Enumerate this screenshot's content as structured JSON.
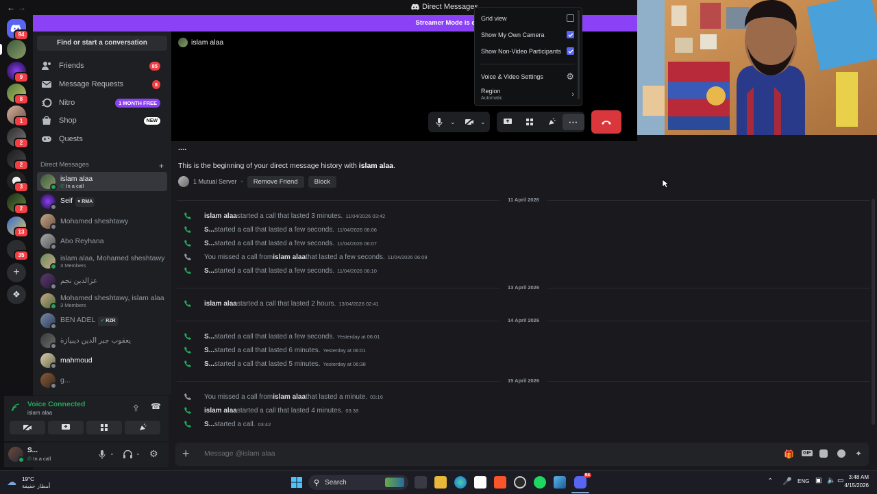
{
  "window": {
    "title": "Direct Messages"
  },
  "banner": {
    "text": "Streamer Mode is enabled. Usernames have b"
  },
  "rail": {
    "servers": [
      {
        "badge": "94"
      },
      {
        "badge": ""
      },
      {
        "badge": "9"
      },
      {
        "badge": "8"
      },
      {
        "badge": "1"
      },
      {
        "badge": "2"
      },
      {
        "badge": "2"
      },
      {
        "badge": "3"
      },
      {
        "badge": "2"
      },
      {
        "badge": "13"
      },
      {
        "badge": "35"
      }
    ]
  },
  "sidebar": {
    "find_label": "Find or start a conversation",
    "nav": [
      {
        "label": "Friends",
        "badge": "85"
      },
      {
        "label": "Message Requests",
        "badge": "8"
      },
      {
        "label": "Nitro",
        "badge": "1 MONTH FREE"
      },
      {
        "label": "Shop",
        "badge": "NEW"
      },
      {
        "label": "Quests",
        "badge": ""
      }
    ],
    "dm_header": "Direct Messages",
    "dms": [
      {
        "name": "islam alaa",
        "sub": "In a call",
        "tag": ""
      },
      {
        "name": "Seif",
        "sub": "",
        "tag": "RMA"
      },
      {
        "name": "Mohamed sheshtawy",
        "sub": "",
        "tag": ""
      },
      {
        "name": "Abo Reyhana",
        "sub": "",
        "tag": ""
      },
      {
        "name": "islam alaa, Mohamed sheshtawy",
        "sub": "3 Members",
        "tag": ""
      },
      {
        "name": "عزالدين نجم",
        "sub": "",
        "tag": ""
      },
      {
        "name": "Mohamed sheshtawy, islam alaa",
        "sub": "3 Members",
        "tag": ""
      },
      {
        "name": "BEN ADEL",
        "sub": "",
        "tag": "RZR"
      },
      {
        "name": "يعقوب جبر الدين ديبيازة",
        "sub": "",
        "tag": ""
      },
      {
        "name": "mahmoud",
        "sub": "",
        "tag": ""
      },
      {
        "name": "g...",
        "sub": "",
        "tag": ""
      }
    ]
  },
  "voice": {
    "status": "Voice Connected",
    "channel": "islam alaa"
  },
  "user": {
    "name": "S...",
    "status": "In a call"
  },
  "call": {
    "participant": "islam alaa"
  },
  "menu": {
    "grid_view": "Grid view",
    "show_camera": "Show My Own Camera",
    "show_nonvideo": "Show Non-Video Participants",
    "av_settings": "Voice & Video Settings",
    "region": "Region",
    "region_value": "Automatic"
  },
  "chat": {
    "ellipsis": "....",
    "intro_prefix": "This is the beginning of your direct message history with ",
    "intro_name": "islam alaa",
    "intro_suffix": ".",
    "mutual": "1 Mutual Server",
    "remove_friend": "Remove Friend",
    "block": "Block",
    "dates": [
      "11 April 2026",
      "13 April 2026",
      "14 April 2026",
      "15 April 2026"
    ],
    "calls": [
      {
        "pre": "",
        "who": "islam alaa",
        "text": " started a call that lasted 3 minutes.",
        "ts": "11/04/2026 03:42"
      },
      {
        "pre": "",
        "who": "S...",
        "text": " started a call that lasted a few seconds.",
        "ts": "11/04/2026 06:06"
      },
      {
        "pre": "",
        "who": "S...",
        "text": " started a call that lasted a few seconds.",
        "ts": "11/04/2026 06:07"
      },
      {
        "pre": "You missed a call from ",
        "who": "islam alaa",
        "text": " that lasted a few seconds.",
        "ts": "11/04/2026 06:09"
      },
      {
        "pre": "",
        "who": "S...",
        "text": " started a call that lasted a few seconds.",
        "ts": "11/04/2026 06:10"
      },
      {
        "pre": "",
        "who": "islam alaa",
        "text": " started a call that lasted 2 hours.",
        "ts": "13/04/2026 02:41"
      },
      {
        "pre": "",
        "who": "S...",
        "text": " started a call that lasted a few seconds.",
        "ts": "Yesterday at 06:01"
      },
      {
        "pre": "",
        "who": "S...",
        "text": " started a call that lasted 6 minutes.",
        "ts": "Yesterday at 06:01"
      },
      {
        "pre": "",
        "who": "S...",
        "text": " started a call that lasted 5 minutes.",
        "ts": "Yesterday at 06:38"
      },
      {
        "pre": "You missed a call from ",
        "who": "islam alaa",
        "text": " that lasted a minute.",
        "ts": "03:16"
      },
      {
        "pre": "",
        "who": "islam alaa",
        "text": " started a call that lasted 4 minutes.",
        "ts": "03:38"
      },
      {
        "pre": "",
        "who": "S...",
        "text": " started a call.",
        "ts": "03:42"
      }
    ],
    "composer_placeholder": "Message @islam alaa"
  },
  "taskbar": {
    "weather_temp": "19°C",
    "weather_desc": "أمطار خفيفة",
    "search": "Search",
    "lang": "ENG",
    "time": "3:48 AM",
    "date": "4/15/2026",
    "discord_badge": "94"
  },
  "colors": {
    "accent": "#5865f2",
    "streamer": "#8b41f5",
    "danger": "#da373c",
    "call_green": "#23a55a"
  }
}
